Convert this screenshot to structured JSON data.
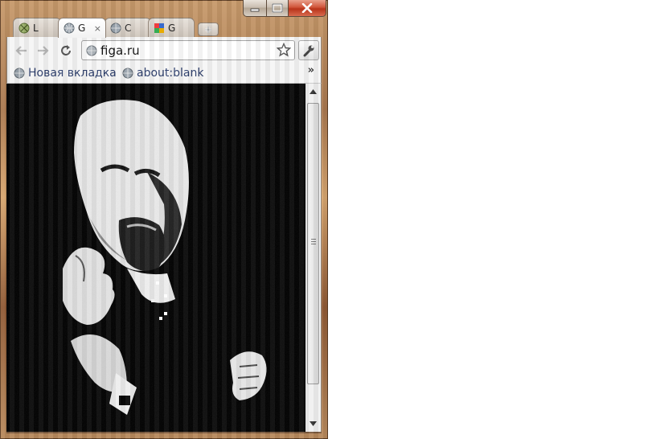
{
  "window": {
    "caption_buttons": [
      "minimize",
      "maximize",
      "close"
    ]
  },
  "tabs": [
    {
      "title": "L",
      "icon": "bug-favicon-icon",
      "active": false
    },
    {
      "title": "G",
      "icon": "globe-icon",
      "active": true,
      "close": "×"
    },
    {
      "title": "C",
      "icon": "globe-icon",
      "active": false
    },
    {
      "title": "G",
      "icon": "google-favicon-icon",
      "active": false
    }
  ],
  "toolbar": {
    "url": "figa.ru"
  },
  "bookmarks": {
    "items": [
      {
        "label": "Новая вкладка",
        "icon": "globe-icon"
      },
      {
        "label": "about:blank",
        "icon": "globe-icon"
      }
    ],
    "overflow": "»"
  },
  "content": {
    "description_icon": "portrait-photo"
  },
  "colors": {
    "frame": "#a9784f",
    "close_button": "#c8401f",
    "bookmark_text": "#2b3d6b",
    "content_bg": "#000000"
  }
}
